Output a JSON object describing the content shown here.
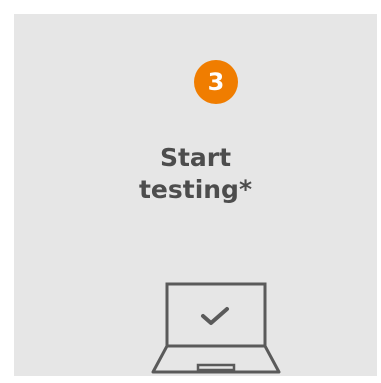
{
  "step": {
    "number": "3",
    "title_line1": "Start",
    "title_line2": "testing*"
  },
  "illustration": {
    "icon": "laptop-check-icon"
  },
  "colors": {
    "background": "#ffffff",
    "card": "#e6e6e6",
    "badge": "#f07d00",
    "text": "#4d4d4d",
    "icon_stroke": "#5a5a5a"
  }
}
